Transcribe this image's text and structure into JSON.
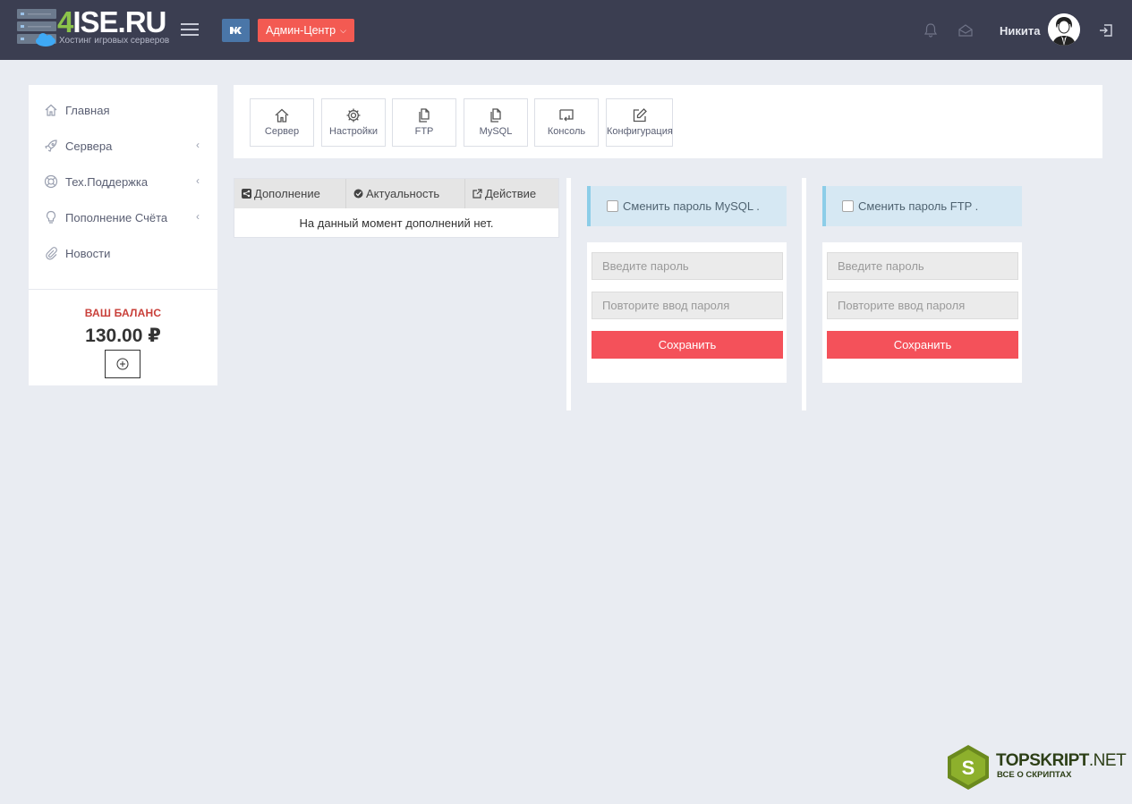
{
  "header": {
    "logo_prefix": "4",
    "logo_rest": "ISE.RU",
    "logo_tagline": "Хостинг игровых серверов",
    "vk_label": "вк",
    "admin_label": "Админ-Центр",
    "user_name": "Никита"
  },
  "sidebar": {
    "items": [
      {
        "label": "Главная",
        "icon": "home-icon",
        "has_arrow": false
      },
      {
        "label": "Сервера",
        "icon": "rocket-icon",
        "has_arrow": true
      },
      {
        "label": "Тех.Поддержка",
        "icon": "lifebuoy-icon",
        "has_arrow": true
      },
      {
        "label": "Пополнение Счёта",
        "icon": "lightbulb-icon",
        "has_arrow": true
      },
      {
        "label": "Новости",
        "icon": "paperclip-icon",
        "has_arrow": false
      }
    ],
    "balance_label": "ВАШ БАЛАНС",
    "balance_value": "130.00 ₽"
  },
  "toolbar": {
    "buttons": [
      {
        "label": "Сервер",
        "icon": "home-icon"
      },
      {
        "label": "Настройки",
        "icon": "gear-icon"
      },
      {
        "label": "FTP",
        "icon": "files-icon"
      },
      {
        "label": "MySQL",
        "icon": "files-icon"
      },
      {
        "label": "Консоль",
        "icon": "console-icon"
      },
      {
        "label": "Конфигурация",
        "icon": "edit-icon"
      }
    ]
  },
  "addons": {
    "columns": [
      "Дополнение",
      "Актуальность",
      "Действие"
    ],
    "empty_text": "На данный момент дополнений нет."
  },
  "mysql": {
    "toggle_label": "Сменить пароль MySQL .",
    "password_placeholder": "Введите пароль",
    "repeat_placeholder": "Повторите ввод пароля",
    "save_label": "Сохранить"
  },
  "ftp": {
    "toggle_label": "Сменить пароль FTP .",
    "password_placeholder": "Введите пароль",
    "repeat_placeholder": "Повторите ввод пароля",
    "save_label": "Сохранить"
  },
  "watermark": {
    "title_bold": "TOPSKRIPT",
    "title_light": ".NET",
    "subtitle": "ВСЕ О СКРИПТАХ",
    "letter": "S"
  },
  "colors": {
    "header_bg": "#3b3e51",
    "accent_red": "#f4515a",
    "admin_btn": "#f35a52",
    "vk_blue": "#4a76a8",
    "logo_green": "#8bc34a",
    "alert_bg": "#d6e8f3"
  }
}
